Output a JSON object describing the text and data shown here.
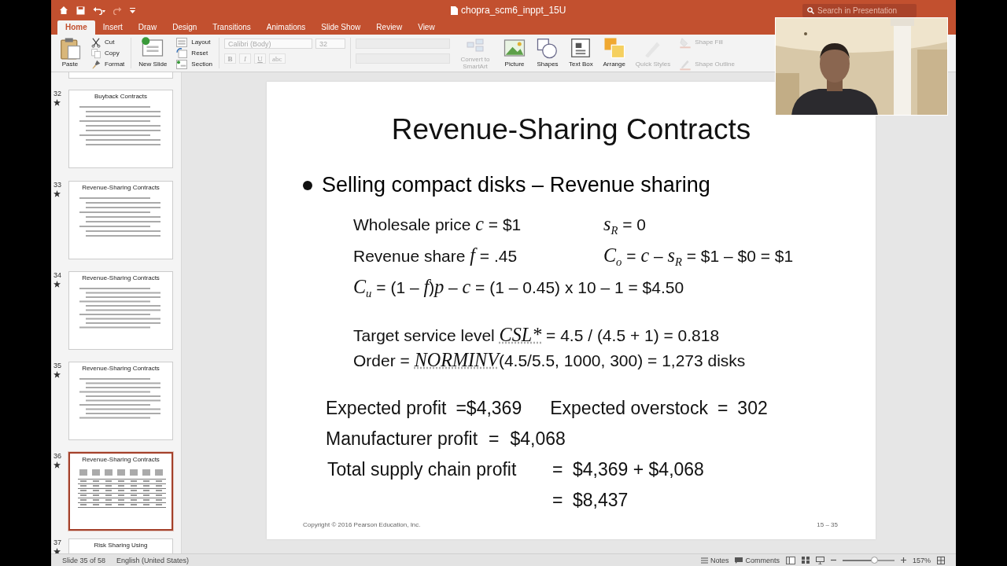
{
  "title_bar": {
    "document": "chopra_scm6_inppt_15U",
    "search": {
      "placeholder": "Search in Presentation"
    }
  },
  "tabs": [
    {
      "label": "Home",
      "selected": true
    },
    {
      "label": "Insert",
      "selected": false
    },
    {
      "label": "Draw",
      "selected": false
    },
    {
      "label": "Design",
      "selected": false
    },
    {
      "label": "Transitions",
      "selected": false
    },
    {
      "label": "Animations",
      "selected": false
    },
    {
      "label": "Slide Show",
      "selected": false
    },
    {
      "label": "Review",
      "selected": false
    },
    {
      "label": "View",
      "selected": false
    }
  ],
  "ribbon": {
    "paste": {
      "label": "Paste",
      "kind": "paste",
      "disabled": false
    },
    "clipboard": [
      {
        "label": "Cut",
        "kind": "scissors"
      },
      {
        "label": "Copy",
        "kind": "copy"
      },
      {
        "label": "Format",
        "kind": "brush"
      }
    ],
    "new_slide": {
      "label": "New Slide",
      "kind": "newslide",
      "disabled": false
    },
    "slides": [
      {
        "label": "Layout",
        "kind": "layout"
      },
      {
        "label": "Reset",
        "kind": "reset"
      },
      {
        "label": "Section",
        "kind": "section"
      }
    ],
    "font_name": "Calibri (Body)",
    "font_size": "32",
    "format_buttons": [
      "B",
      "I",
      "U",
      "abc"
    ],
    "large": [
      {
        "label": "Convert to SmartArt",
        "kind": "smartart",
        "disabled": true
      },
      {
        "label": "Picture",
        "kind": "picture",
        "disabled": false
      },
      {
        "label": "Shapes",
        "kind": "shapes",
        "disabled": false
      },
      {
        "label": "Text Box",
        "kind": "textbox",
        "disabled": false
      },
      {
        "label": "Arrange",
        "kind": "arrange",
        "disabled": false
      },
      {
        "label": "Quick Styles",
        "kind": "styles",
        "disabled": true
      }
    ],
    "shape_format": [
      {
        "label": "Shape Fill",
        "kind": "fill",
        "disabled": true
      },
      {
        "label": "Shape Outline",
        "kind": "outline",
        "disabled": true
      }
    ]
  },
  "thumbnails": [
    {
      "number": "32",
      "title": "Buyback Contracts",
      "kind": "bullets",
      "selected": false
    },
    {
      "number": "33",
      "title": "Revenue-Sharing Contracts",
      "kind": "bullets",
      "selected": false
    },
    {
      "number": "34",
      "title": "Revenue-Sharing Contracts",
      "kind": "formulas",
      "selected": false
    },
    {
      "number": "35",
      "title": "Revenue-Sharing Contracts",
      "kind": "formulas",
      "selected": false
    },
    {
      "number": "36",
      "title": "Revenue-Sharing Contracts",
      "kind": "table",
      "selected": true
    },
    {
      "number": "37",
      "title": "Risk Sharing Using",
      "kind": "partial",
      "selected": false
    }
  ],
  "slide": {
    "title": "Revenue-Sharing Contracts",
    "bullet": "Selling compact disks – Revenue sharing",
    "formulas": [
      {
        "left": "Wholesale price *c* = $1",
        "right": "*s*$_{R}$ = 0"
      },
      {
        "left": "Revenue share *f* = .45",
        "right": "*C*$_{o}$ = *c* – *s*$_{R}$ = $1 – $0 = $1"
      }
    ],
    "formula_wide": "*C*$_{u}$ = (1 – *f*)*p* – *c* = (1 – 0.45) x 10 – 1 = $4.50",
    "service": [
      {
        "before": "Target service level ",
        "italic": "CSL*",
        "after": " = 4.5 / (4.5 + 1) = 0.818"
      },
      {
        "before": "Order = ",
        "italic": "NORMINV",
        "after": "(4.5/5.5, 1000, 300) = 1,273 disks"
      }
    ],
    "row_1": [
      "Expected profit",
      "=$4,369",
      "Expected overstock",
      "=",
      "302"
    ],
    "row_2": [
      "Manufacturer profit",
      "=",
      "$4,068"
    ],
    "total": [
      "Total supply chain profit",
      "=",
      "$4,369 + $4,068"
    ],
    "total_cont": [
      "=",
      "$8,437"
    ],
    "copyright": "Copyright © 2016 Pearson Education, Inc.",
    "page": "15 – 35"
  },
  "status_bar": {
    "slide": "Slide 35 of 58",
    "language": "English (United States)",
    "notes": "Notes",
    "comments": "Comments",
    "zoom": {
      "level": 0.6
    },
    "zoom_text": "157%"
  }
}
